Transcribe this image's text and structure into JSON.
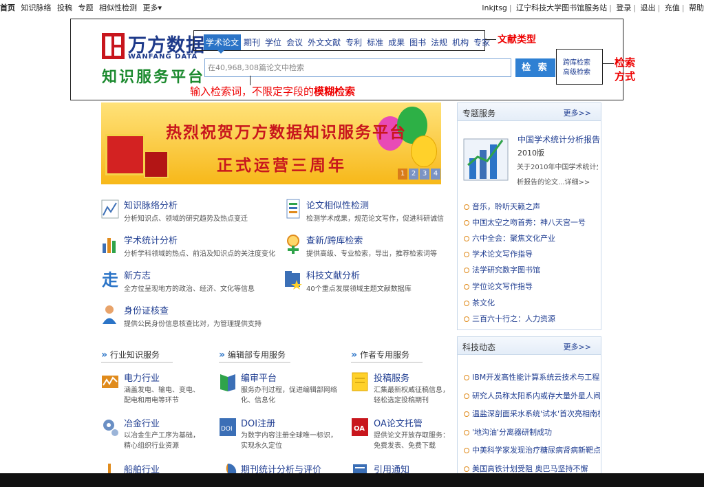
{
  "topbar": {
    "left_items": [
      "首页",
      "知识脉络",
      "投稿",
      "专题",
      "相似性检测",
      "更多▾"
    ],
    "user": "lnkjtsg",
    "right_items": [
      "辽宁科技大学图书馆服务站",
      "登录",
      "退出",
      "充值",
      "帮助"
    ]
  },
  "logo": {
    "cn": "万方数据",
    "en": "WANFANG DATA",
    "sub": "知识服务平台"
  },
  "doc_types": [
    "学术论文",
    "期刊",
    "学位",
    "会议",
    "外文文献",
    "专利",
    "标准",
    "成果",
    "图书",
    "法规",
    "机构",
    "专家"
  ],
  "search": {
    "placeholder": "在40,968,308篇论文中检索",
    "button": "检 索",
    "cross_db": "跨库检索",
    "advanced": "高级检索"
  },
  "annotations": {
    "doc_type": "文献类型",
    "method_1": "检索",
    "method_2": "方式",
    "input_a": "输入检索词，不限定字段的",
    "input_b": "模糊检索"
  },
  "banner": {
    "line1": "热烈祝贺万方数据知识服务平台",
    "line2": "正式运营三周年",
    "pages": [
      "1",
      "2",
      "3",
      "4"
    ]
  },
  "services": [
    {
      "title": "知识脉络分析",
      "desc": "分析知识点、领域的研究趋势及热点变迁",
      "icon": "trend-chart-icon"
    },
    {
      "title": "论文相似性检测",
      "desc": "检测学术成果，规范论文写作，促进科研诚信",
      "icon": "document-check-icon"
    },
    {
      "title": "学术统计分析",
      "desc": "分析学科领域的热点、前沿及知识点的关注度变化",
      "icon": "bar-chart-icon"
    },
    {
      "title": "查新/跨库检索",
      "desc": "提供高级、专业检索，导出，推荐检索词等",
      "icon": "magnifier-plus-icon"
    },
    {
      "title": "新方志",
      "desc": "全方位呈现地方的政治、经济、文化等信息",
      "icon": "walk-glyph-icon"
    },
    {
      "title": "科技文献分析",
      "desc": "40个重点发展领域主题文献数据库",
      "icon": "folder-star-icon"
    },
    {
      "title": "身份证核查",
      "desc": "提供公民身份信息核查比对，为管理提供支持",
      "icon": "person-icon"
    }
  ],
  "sections": {
    "industry": "行业知识服务",
    "editorial": "编辑部专用服务",
    "author": "作者专用服务"
  },
  "services2": [
    {
      "title": "电力行业",
      "desc1": "涵盖发电、输电、变电、",
      "desc2": "配电和用电等环节",
      "icon": "power-icon"
    },
    {
      "title": "编审平台",
      "desc1": "服务办刊过程，促进编辑部网络",
      "desc2": "化、信息化",
      "icon": "book-icon"
    },
    {
      "title": "投稿服务",
      "desc1": "汇集最新权威征稿信息，",
      "desc2": "轻松选定投稿期刊",
      "icon": "note-icon"
    },
    {
      "title": "冶金行业",
      "desc1": "以冶金生产工序为基础，",
      "desc2": "精心组织行业资源",
      "icon": "gear-icon"
    },
    {
      "title": "DOI注册",
      "desc1": "为数字内容注册全球唯一标识，",
      "desc2": "实现永久定位",
      "icon": "doi-icon"
    },
    {
      "title": "OA论文托管",
      "desc1": "提供论文开放存取服务：",
      "desc2": "免费发表、免费下载",
      "icon": "oa-icon"
    },
    {
      "title": "船舶行业",
      "icon": "ship-icon"
    },
    {
      "title": "期刊统计分析与评价",
      "icon": "pie-icon"
    },
    {
      "title": "引用通知",
      "icon": "notice-icon"
    }
  ],
  "sidebar": {
    "special": {
      "title": "专题服务",
      "more": "更多>>",
      "feature_title": "中国学术统计分析报告",
      "feature_sub": "2010版",
      "feature_desc1": "关于2010年中国学术统计分",
      "feature_desc2": "析报告的论文...详细>>",
      "items": [
        "音乐，聆听天籁之声",
        "中国太空之吻首秀：神八天宫一号",
        "六中全会：聚焦文化产业",
        "学术论文写作指导",
        "法学研究数字图书馆",
        "学位论文写作指导",
        "茶文化",
        "三百六十行之：人力资源"
      ]
    },
    "news": {
      "title": "科技动态",
      "more": "更多>>",
      "items": [
        "IBM开发高性能计算系统云技术与工程服务",
        "研究人员称太阳系内或存大量外星人间候标志",
        "温盐深剖面采水系统'试水'首次亮相南极大洋",
        "'地沟油'分离器研制成功",
        "中美科学家发现治疗糖尿病肾病新靶点",
        "美国高铁计划受阻 奥巴马坚持不懈"
      ]
    }
  },
  "colors": {
    "brand_blue": "#1e3a8a",
    "tab_blue": "#2b74c7",
    "accent_red": "#e00",
    "brand_green": "#1c8a2f"
  }
}
